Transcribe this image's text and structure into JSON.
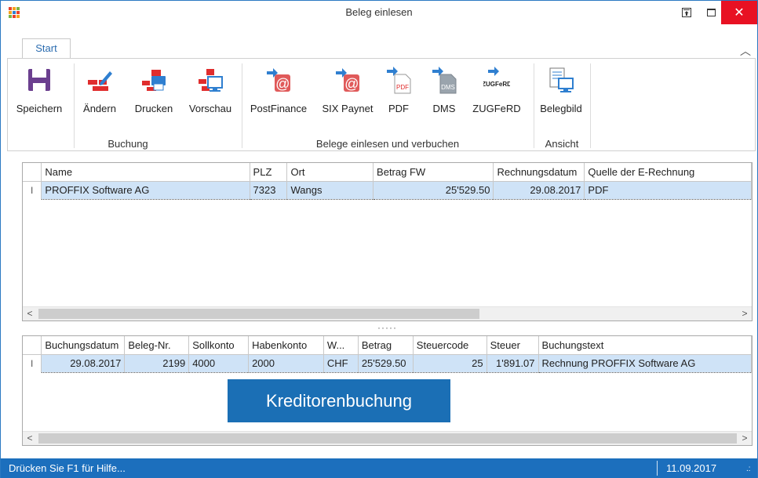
{
  "window": {
    "title": "Beleg einlesen"
  },
  "ribbon": {
    "tab": "Start",
    "groups": [
      {
        "label": "Buchung"
      },
      {
        "label": "Belege einlesen und verbuchen"
      },
      {
        "label": "Ansicht"
      }
    ],
    "buttons": [
      {
        "label": "Speichern",
        "icon": "save-icon"
      },
      {
        "label": "Ändern",
        "icon": "edit-icon"
      },
      {
        "label": "Drucken",
        "icon": "print-icon"
      },
      {
        "label": "Vorschau",
        "icon": "preview-icon"
      },
      {
        "label": "PostFinance",
        "icon": "postfinance-import-icon"
      },
      {
        "label": "SIX Paynet",
        "icon": "paynet-import-icon"
      },
      {
        "label": "PDF",
        "icon": "pdf-import-icon"
      },
      {
        "label": "DMS",
        "icon": "dms-import-icon"
      },
      {
        "label": "ZUGFeRD",
        "icon": "zugferd-import-icon"
      },
      {
        "label": "Belegbild",
        "icon": "document-image-icon"
      }
    ],
    "icon_text": {
      "pdf": "PDF",
      "dms": "DMS",
      "zugferd": "ZUGFeRD"
    }
  },
  "grid1": {
    "columns": [
      "Name",
      "PLZ",
      "Ort",
      "Betrag FW",
      "Rechnungsdatum",
      "Quelle der E-Rechnung"
    ],
    "rows": [
      [
        "PROFFIX Software AG",
        "7323",
        "Wangs",
        "25'529.50",
        "29.08.2017",
        "PDF"
      ]
    ]
  },
  "grid2": {
    "columns": [
      "Buchungsdatum",
      "Beleg-Nr.",
      "Sollkonto",
      "Habenkonto",
      "W...",
      "Betrag",
      "Steuercode",
      "Steuer",
      "Buchungstext"
    ],
    "rows": [
      [
        "29.08.2017",
        "2199",
        "4000",
        "2000",
        "CHF",
        "25'529.50",
        "25",
        "1'891.07",
        "Rechnung PROFFIX Software AG"
      ]
    ]
  },
  "overlay": {
    "label": "Kreditorenbuchung"
  },
  "statusbar": {
    "help": "Drücken Sie F1 für Hilfe...",
    "date": "11.09.2017"
  },
  "colors": {
    "accent": "#1c6fbd",
    "close": "#e81123",
    "selection": "#cfe3f7",
    "icon_red": "#e02d2d",
    "icon_purple": "#6b3f8f",
    "icon_blue": "#2f7fd0"
  }
}
